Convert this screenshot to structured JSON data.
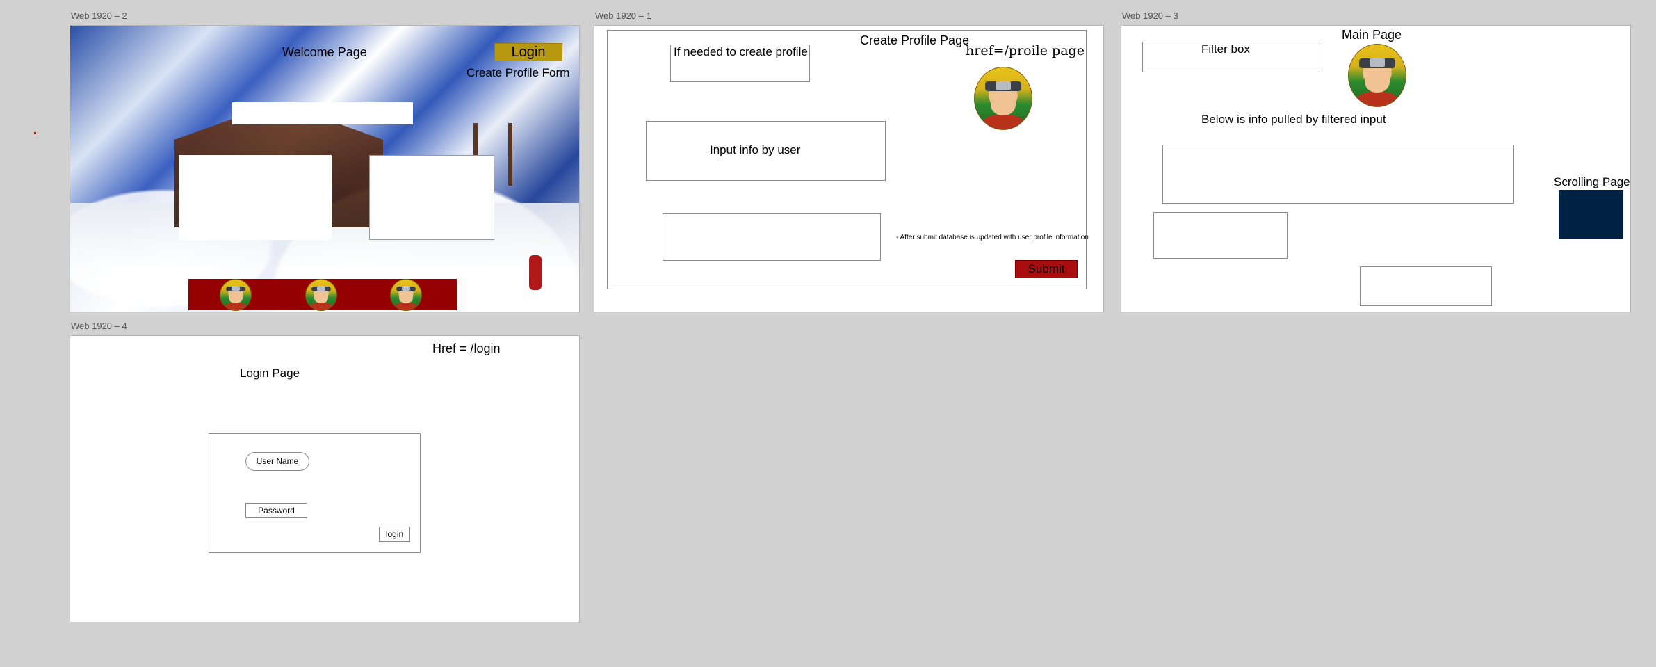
{
  "frames": {
    "welcome": {
      "label": "Web 1920 – 2",
      "title": "Welcome Page",
      "login_button": "Login",
      "create_profile_link": "Create Profile Form"
    },
    "create_profile": {
      "label": "Web 1920 – 1",
      "title": "Create Profile Page",
      "href_note": "href=/proile page",
      "if_needed_note": "If needed to create profile",
      "input_info_note": "Input info by user",
      "after_submit_note": "- After submit database is updated with user profile information",
      "submit_button": "Submit"
    },
    "main": {
      "label": "Web 1920 – 3",
      "title": "Main Page",
      "filter_box": "Filter box",
      "below_info_note": "Below is info pulled by filtered input",
      "scrolling_note": "Scrolling Page"
    },
    "login": {
      "label": "Web 1920 – 4",
      "title": "Login Page",
      "href_note": "Href = /login",
      "username_placeholder": "User Name",
      "password_placeholder": "Password",
      "login_button": "login"
    }
  },
  "colors": {
    "canvas": "#d1d1d1",
    "gold_button": "#b8980e",
    "red_banner": "#950000",
    "submit_red": "#aa0d0d",
    "navy_block": "#002242"
  },
  "icons": [
    "avatar-icon"
  ]
}
